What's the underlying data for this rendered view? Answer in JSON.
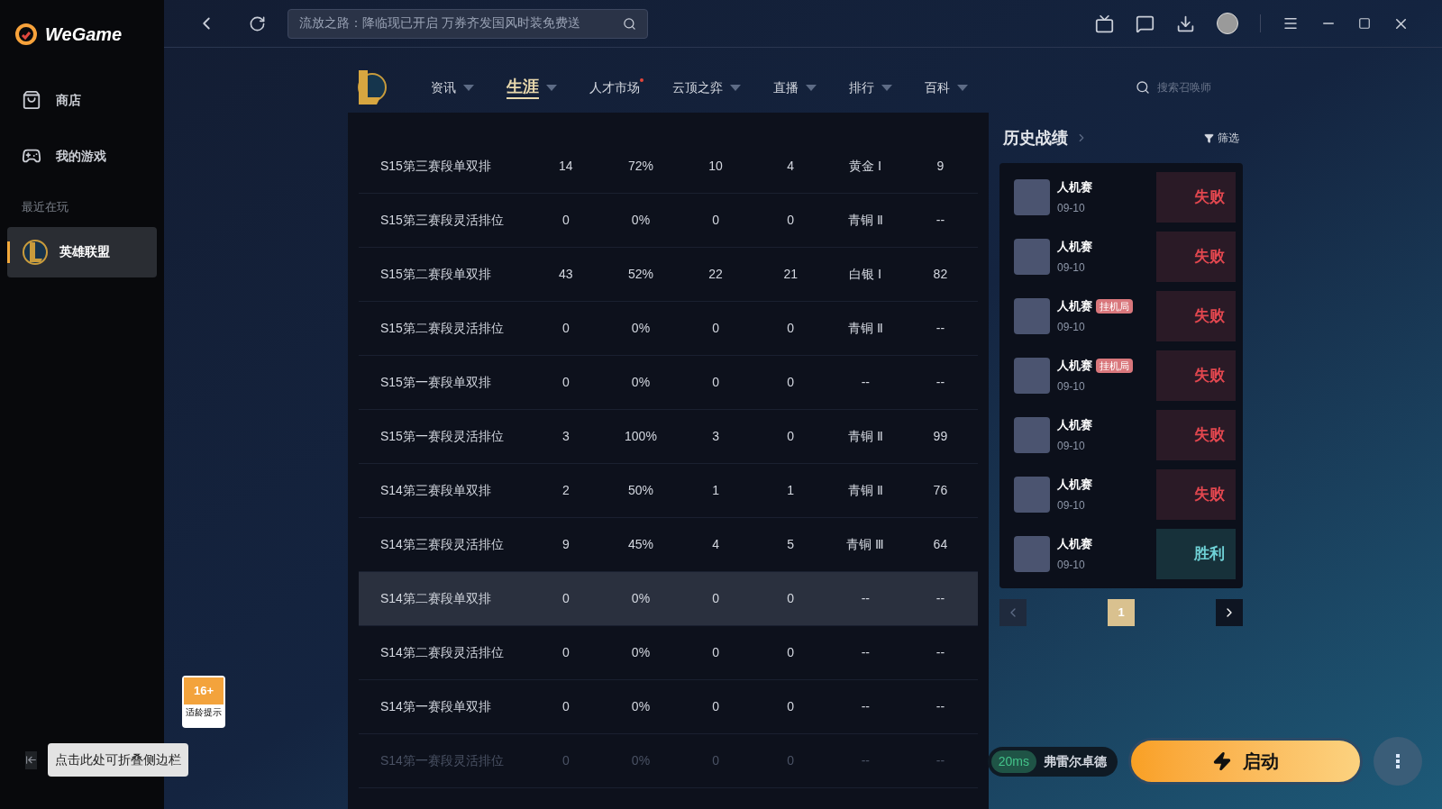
{
  "sidebar": {
    "logo": "WeGame",
    "items": [
      {
        "label": "商店",
        "kind": "store",
        "selected": false
      },
      {
        "label": "我的游戏",
        "kind": "games",
        "selected": false
      }
    ],
    "section_title": "最近在玩",
    "recent": [
      {
        "label": "英雄联盟",
        "selected": true
      }
    ],
    "age_rating": {
      "rating": "16+",
      "caption": "适龄提示"
    },
    "collapse_tip": "点击此处可折叠侧边栏"
  },
  "top_bar": {
    "search": {
      "value": "流放之路：降临现已开启 万券齐发国风时装免费送"
    }
  },
  "game_nav": {
    "items": [
      {
        "label": "资讯",
        "selected": false,
        "dropdown": true,
        "dot": false
      },
      {
        "label": "生涯",
        "selected": true,
        "dropdown": true,
        "dot": false
      },
      {
        "label": "人才市场",
        "selected": false,
        "dropdown": false,
        "dot": true
      },
      {
        "label": "云顶之弈",
        "selected": false,
        "dropdown": true,
        "dot": false
      },
      {
        "label": "直播",
        "selected": false,
        "dropdown": true,
        "dot": false
      },
      {
        "label": "排行",
        "selected": false,
        "dropdown": true,
        "dot": false
      },
      {
        "label": "百科",
        "selected": false,
        "dropdown": true,
        "dot": false
      }
    ],
    "search": {
      "placeholder": "搜索召唤师"
    }
  },
  "table": {
    "rows": [
      {
        "cells": [
          "S15第三赛段单双排",
          "14",
          "72%",
          "10",
          "4",
          "黄金 Ⅰ",
          "9"
        ],
        "selected": false,
        "faded": false
      },
      {
        "cells": [
          "S15第三赛段灵活排位",
          "0",
          "0%",
          "0",
          "0",
          "青铜 Ⅱ",
          "--"
        ],
        "selected": false,
        "faded": false
      },
      {
        "cells": [
          "S15第二赛段单双排",
          "43",
          "52%",
          "22",
          "21",
          "白银 Ⅰ",
          "82"
        ],
        "selected": false,
        "faded": false
      },
      {
        "cells": [
          "S15第二赛段灵活排位",
          "0",
          "0%",
          "0",
          "0",
          "青铜 Ⅱ",
          "--"
        ],
        "selected": false,
        "faded": false
      },
      {
        "cells": [
          "S15第一赛段单双排",
          "0",
          "0%",
          "0",
          "0",
          "--",
          "--"
        ],
        "selected": false,
        "faded": false
      },
      {
        "cells": [
          "S15第一赛段灵活排位",
          "3",
          "100%",
          "3",
          "0",
          "青铜 Ⅱ",
          "99"
        ],
        "selected": false,
        "faded": false
      },
      {
        "cells": [
          "S14第三赛段单双排",
          "2",
          "50%",
          "1",
          "1",
          "青铜 Ⅱ",
          "76"
        ],
        "selected": false,
        "faded": false
      },
      {
        "cells": [
          "S14第三赛段灵活排位",
          "9",
          "45%",
          "4",
          "5",
          "青铜 Ⅲ",
          "64"
        ],
        "selected": false,
        "faded": false
      },
      {
        "cells": [
          "S14第二赛段单双排",
          "0",
          "0%",
          "0",
          "0",
          "--",
          "--"
        ],
        "selected": true,
        "faded": false
      },
      {
        "cells": [
          "S14第二赛段灵活排位",
          "0",
          "0%",
          "0",
          "0",
          "--",
          "--"
        ],
        "selected": false,
        "faded": false
      },
      {
        "cells": [
          "S14第一赛段单双排",
          "0",
          "0%",
          "0",
          "0",
          "--",
          "--"
        ],
        "selected": false,
        "faded": false
      },
      {
        "cells": [
          "S14第一赛段灵活排位",
          "0",
          "0%",
          "0",
          "0",
          "--",
          "--"
        ],
        "selected": false,
        "faded": true
      }
    ]
  },
  "history": {
    "title": "历史战绩",
    "filter": "筛选",
    "matches": [
      {
        "mode": "人机赛",
        "date": "09-10",
        "result": "失败",
        "kind": "loss"
      },
      {
        "mode": "人机赛",
        "date": "09-10",
        "result": "失败",
        "kind": "loss"
      },
      {
        "mode": "人机赛",
        "date": "09-10",
        "badge": "挂机局",
        "result": "失败",
        "kind": "loss"
      },
      {
        "mode": "人机赛",
        "date": "09-10",
        "badge": "挂机局",
        "result": "失败",
        "kind": "loss"
      },
      {
        "mode": "人机赛",
        "date": "09-10",
        "result": "失败",
        "kind": "loss"
      },
      {
        "mode": "人机赛",
        "date": "09-10",
        "result": "失败",
        "kind": "loss"
      },
      {
        "mode": "人机赛",
        "date": "09-10",
        "result": "胜利",
        "kind": "win"
      }
    ],
    "pages": [
      {
        "label": "1",
        "selected": true
      }
    ]
  },
  "launch_bar": {
    "ping": "20ms",
    "server": "弗雷尔卓德",
    "launch": "启动"
  }
}
